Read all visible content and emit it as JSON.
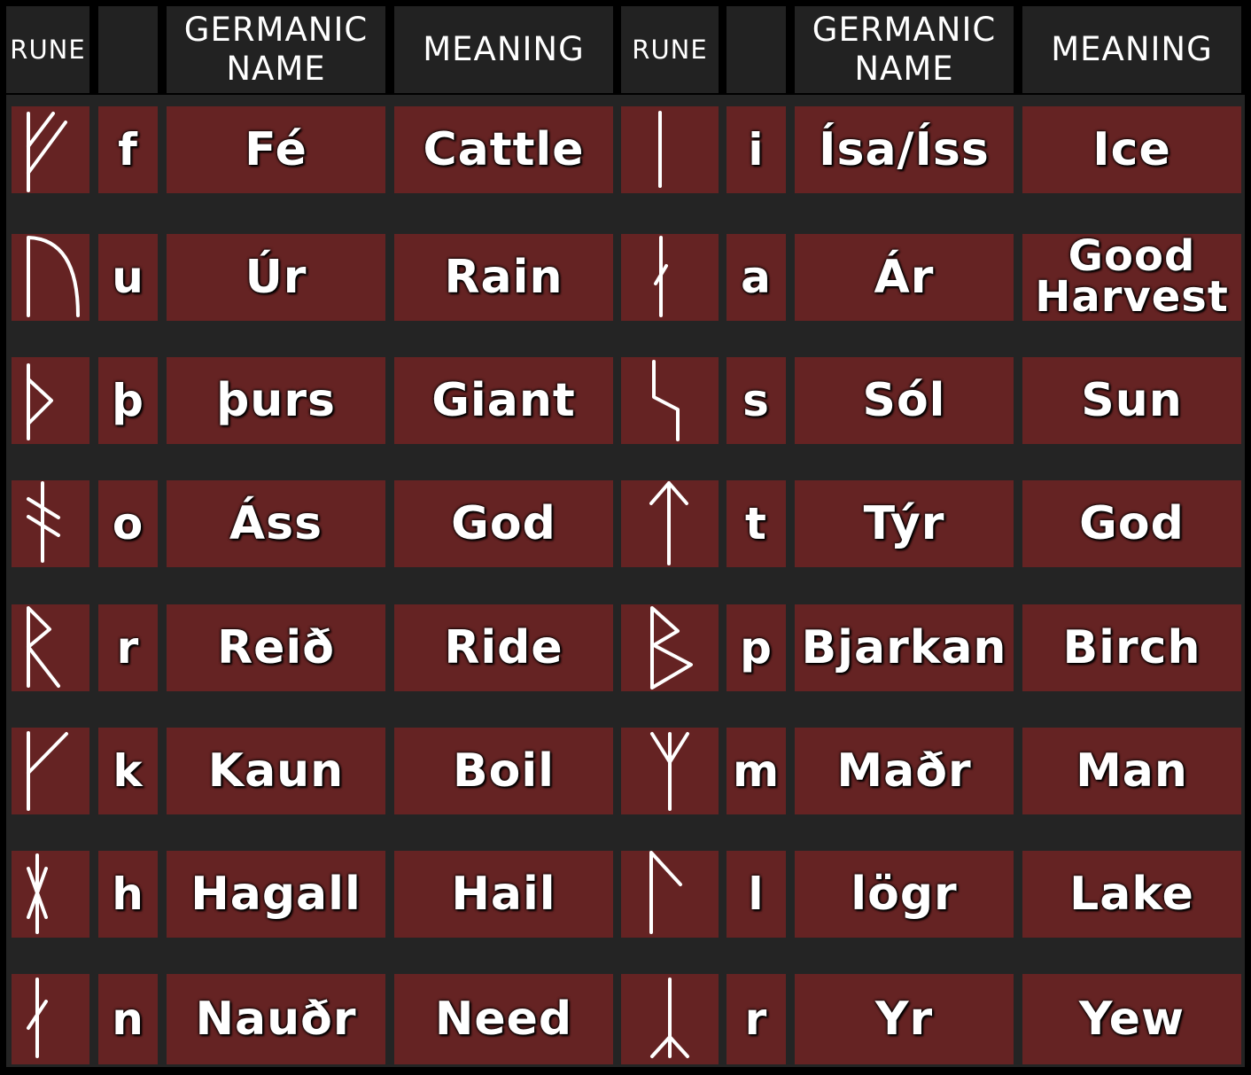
{
  "headers": {
    "rune": "RUNE",
    "germanic_name": "GERMANIC NAME",
    "meaning": "MEANING"
  },
  "rows_left": [
    {
      "rune": "fe",
      "letter": "f",
      "name": "Fé",
      "meaning": "Cattle"
    },
    {
      "rune": "ur",
      "letter": "u",
      "name": "Úr",
      "meaning": "Rain"
    },
    {
      "rune": "thurs",
      "letter": "þ",
      "name": "þurs",
      "meaning": "Giant"
    },
    {
      "rune": "ass",
      "letter": "o",
      "name": "Áss",
      "meaning": "God"
    },
    {
      "rune": "reid",
      "letter": "r",
      "name": "Reið",
      "meaning": "Ride"
    },
    {
      "rune": "kaun",
      "letter": "k",
      "name": "Kaun",
      "meaning": "Boil"
    },
    {
      "rune": "hagall",
      "letter": "h",
      "name": "Hagall",
      "meaning": "Hail"
    },
    {
      "rune": "naudr",
      "letter": "n",
      "name": "Nauðr",
      "meaning": "Need"
    }
  ],
  "rows_right": [
    {
      "rune": "isa",
      "letter": "i",
      "name": "Ísa/Íss",
      "meaning": "Ice"
    },
    {
      "rune": "ar",
      "letter": "a",
      "name": "Ár",
      "meaning_line1": "Good",
      "meaning_line2": "Harvest"
    },
    {
      "rune": "sol",
      "letter": "s",
      "name": "Sól",
      "meaning": "Sun"
    },
    {
      "rune": "tyr",
      "letter": "t",
      "name": "Týr",
      "meaning": "God"
    },
    {
      "rune": "bjarkan",
      "letter": "p",
      "name": "Bjarkan",
      "meaning": "Birch"
    },
    {
      "rune": "madr",
      "letter": "m",
      "name": "Maðr",
      "meaning": "Man"
    },
    {
      "rune": "logr",
      "letter": "l",
      "name": "lögr",
      "meaning": "Lake"
    },
    {
      "rune": "yr",
      "letter": "r",
      "name": "Yr",
      "meaning": "Yew"
    }
  ],
  "colors": {
    "background": "#000000",
    "band": "#242424",
    "header_cell": "#222222",
    "data_cell": "#652323",
    "text": "#ffffff"
  }
}
